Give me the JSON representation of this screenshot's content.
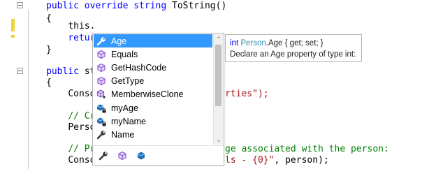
{
  "editor": {
    "line1": {
      "kw": "public override string",
      "rest": " ToString()"
    },
    "line2": "{",
    "line3": {
      "indent": "    ",
      "text": "this."
    },
    "line4": {
      "indent": "    ",
      "text": "retur"
    },
    "line5": "}",
    "line7": {
      "kw": "public",
      "rest": " st"
    },
    "line8": "{",
    "line9": {
      "indent": "    ",
      "text": "Conso",
      "tail": "rties\");"
    },
    "line11": {
      "indent": "    ",
      "comment": "// Cr"
    },
    "line12": {
      "indent": "    ",
      "text": "Perso"
    },
    "line14": {
      "indent": "    ",
      "comment_a": "// Pr",
      "comment_b": "ge associated with the person:"
    },
    "line15": {
      "indent": "    ",
      "text": "Conso",
      "tail_str": "ls - {0}\"",
      "tail": ", person);"
    }
  },
  "completion": {
    "items": [
      {
        "label": "Age",
        "icon": "wrench-property-icon",
        "selected": true
      },
      {
        "label": "Equals",
        "icon": "method-cube-icon"
      },
      {
        "label": "GetHashCode",
        "icon": "method-cube-icon"
      },
      {
        "label": "GetType",
        "icon": "method-cube-icon"
      },
      {
        "label": "MemberwiseClone",
        "icon": "protected-method-icon"
      },
      {
        "label": "myAge",
        "icon": "private-field-icon"
      },
      {
        "label": "myName",
        "icon": "private-field-icon"
      },
      {
        "label": "Name",
        "icon": "wrench-property-icon"
      }
    ],
    "filters": [
      "property-filter-icon",
      "method-filter-icon",
      "field-filter-icon"
    ]
  },
  "tooltip": {
    "kw": "int",
    "type": "Person",
    "member": ".Age { get; set; }",
    "description": "Declare an Age property of type int:"
  },
  "colors": {
    "keyword": "#0000ff",
    "string": "#a31515",
    "comment": "#008000",
    "selection": "#3399ff",
    "change_bar": "#f3d13a",
    "method_icon": "#8a4bd6",
    "field_icon": "#1d6fb8"
  }
}
